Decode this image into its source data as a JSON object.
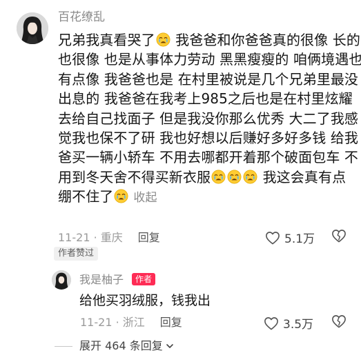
{
  "comment": {
    "username": "百花缭乱",
    "lines": [
      [
        {
          "t": "text",
          "v": "兄弟我真看哭了"
        },
        {
          "t": "emoji"
        },
        {
          "t": "text",
          "v": " 我爸爸和你爸爸真的很像 长的"
        }
      ],
      [
        {
          "t": "text",
          "v": "也很像 也是从事体力劳动 黑黑瘦瘦的 咱俩境遇也"
        }
      ],
      [
        {
          "t": "text",
          "v": "有点像 我爸爸也是 在村里被说是几个兄弟里最没"
        }
      ],
      [
        {
          "t": "text",
          "v": "出息的 我爸爸在我考上985之后也是在村里炫耀"
        }
      ],
      [
        {
          "t": "text",
          "v": "去给自己找面子 但是我没你那么优秀 大二了我感"
        }
      ],
      [
        {
          "t": "text",
          "v": "觉我也保不了研 我也好想以后赚好多好多钱 给我"
        }
      ],
      [
        {
          "t": "text",
          "v": "爸买一辆小轿车 不用去哪都开着那个破面包车 不"
        }
      ],
      [
        {
          "t": "text",
          "v": "用到冬天舍不得买新衣服"
        },
        {
          "t": "emoji"
        },
        {
          "t": "emoji"
        },
        {
          "t": "emoji"
        },
        {
          "t": "text",
          "v": " 我这会真有点"
        }
      ],
      [
        {
          "t": "text",
          "v": "绷不住了"
        },
        {
          "t": "emoji"
        },
        {
          "t": "collapse"
        }
      ]
    ],
    "collapse_label": "收起",
    "date": "11-21",
    "location": "重庆",
    "reply_label": "回复",
    "likes": "5.1万",
    "author_liked": "作者赞过"
  },
  "reply": {
    "username": "我是柚子",
    "badge": "作者",
    "text": "给他买羽绒服，钱我出",
    "date": "11-21",
    "location": "浙江",
    "reply_label": "回复",
    "likes": "3.5万"
  },
  "expand": {
    "label": "展开 464 条回复"
  },
  "icons": {
    "emoji": "crying-face-icon",
    "like": "heart-outline-icon",
    "dislike": "broken-heart-outline-icon",
    "expand": "chevron-down-icon"
  },
  "colors": {
    "badge": "#fe2c55",
    "meta_text": "#9a9a9a",
    "body_text": "#161616"
  }
}
